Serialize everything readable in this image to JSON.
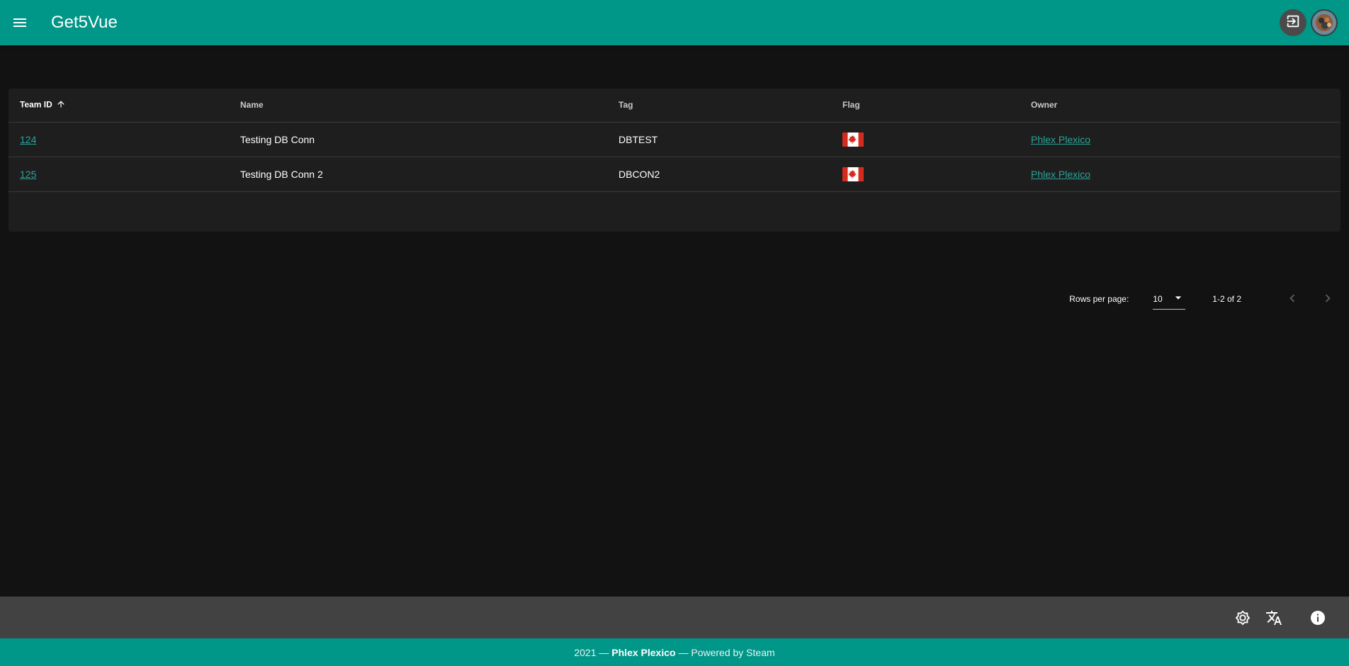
{
  "header": {
    "title": "Get5Vue",
    "menu_icon": "menu-icon",
    "logout_icon": "logout-icon",
    "avatar_alt": "user-avatar"
  },
  "table": {
    "columns": [
      "Team ID",
      "Name",
      "Tag",
      "Flag",
      "Owner"
    ],
    "sort_column": "Team ID",
    "sort_direction": "ascending",
    "rows": [
      {
        "id": "124",
        "name": "Testing DB Conn",
        "tag": "DBTEST",
        "flag": "canada-flag-icon",
        "owner": "Phlex Plexico"
      },
      {
        "id": "125",
        "name": "Testing DB Conn 2",
        "tag": "DBCON2",
        "flag": "canada-flag-icon",
        "owner": "Phlex Plexico"
      }
    ],
    "rows_per_page_label": "Rows per page:",
    "rows_per_page": "10",
    "range": "1-2 of 2"
  },
  "bottom_bar": {
    "icons": [
      "theme-icon",
      "translate-icon",
      "info-icon"
    ]
  },
  "footer": {
    "year": "2021",
    "dash1": " — ",
    "author": "Phlex Plexico",
    "powered": " — Powered by Steam"
  },
  "colors": {
    "primary": "#009688",
    "link": "#26a69a",
    "background": "#121212",
    "card": "#1e1e1e"
  }
}
